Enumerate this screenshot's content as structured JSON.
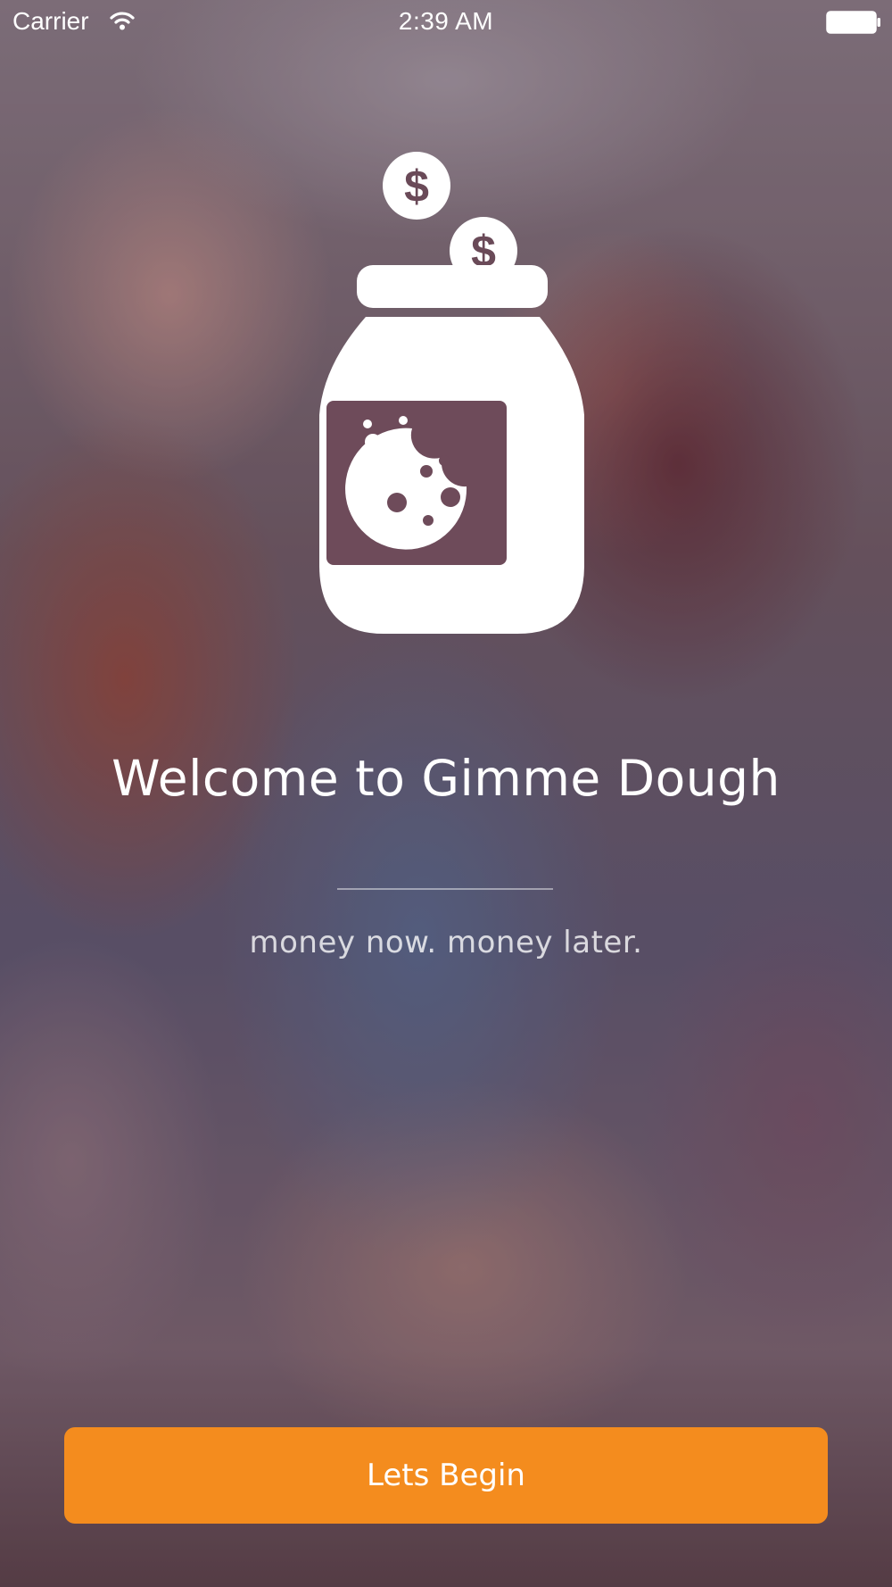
{
  "status_bar": {
    "carrier": "Carrier",
    "time": "2:39 AM",
    "wifi_icon": "wifi-icon",
    "battery_icon": "battery-full-icon"
  },
  "logo": {
    "icon": "cookie-jar-with-coins-icon",
    "coin_symbol": "$"
  },
  "welcome": {
    "title": "Welcome to Gimme Dough",
    "tagline": "money now. money later."
  },
  "actions": {
    "begin_label": "Lets Begin"
  },
  "colors": {
    "accent": "#f48c1e",
    "text": "#ffffff"
  }
}
